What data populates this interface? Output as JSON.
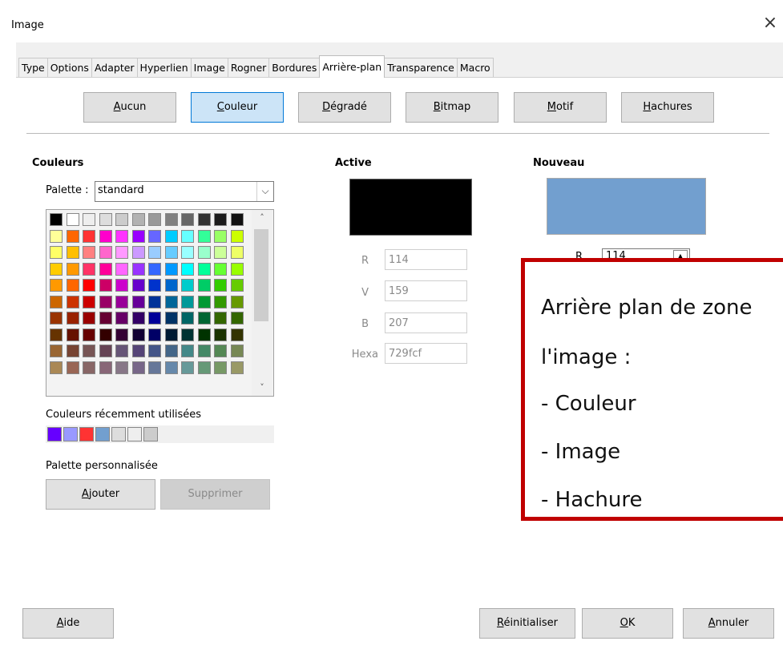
{
  "window": {
    "title": "Image",
    "close": "×"
  },
  "tabs": [
    "Type",
    "Options",
    "Adapter",
    "Hyperlien",
    "Image",
    "Rogner",
    "Bordures",
    "Arrière-plan",
    "Transparence",
    "Macro"
  ],
  "active_tab": "Arrière-plan",
  "fill_types": [
    {
      "key": "A",
      "rest": "ucun"
    },
    {
      "key": "C",
      "rest": "ouleur"
    },
    {
      "key": "D",
      "rest": "égradé"
    },
    {
      "key": "B",
      "rest": "itmap"
    },
    {
      "key": "M",
      "rest": "otif"
    },
    {
      "key": "H",
      "rest": "achures"
    }
  ],
  "colors_section": {
    "title": "Couleurs",
    "palette_label": "Palette :",
    "palette_value": "standard",
    "recent_label": "Couleurs récemment utilisées",
    "custom_label": "Palette personnalisée",
    "add_key": "A",
    "add_rest": "jouter",
    "delete_label": "Supprimer"
  },
  "palette_colors": [
    [
      "#000000",
      "#ffffff",
      "#eeeeee",
      "#dddddd",
      "#cccccc",
      "#b2b2b2",
      "#999999",
      "#808080",
      "#666666",
      "#333333",
      "#1c1c1c",
      "#111111"
    ],
    [
      "#ffff99",
      "#ff6600",
      "#ff3333",
      "#ff00cc",
      "#ff33ff",
      "#9900ff",
      "#6666ff",
      "#00ccff",
      "#66ffff",
      "#33ff99",
      "#99ff66",
      "#ccff00"
    ],
    [
      "#ffff66",
      "#ffbf00",
      "#ff8080",
      "#ff66cc",
      "#ff99ff",
      "#cc99ff",
      "#99ccff",
      "#66ccff",
      "#99ffff",
      "#99ffcc",
      "#ccff99",
      "#eeff66"
    ],
    [
      "#ffcc00",
      "#ff9900",
      "#ff3366",
      "#ff0099",
      "#ff66ff",
      "#9933ff",
      "#3366ff",
      "#0099ff",
      "#00ffff",
      "#00ff99",
      "#66ff33",
      "#99ff00"
    ],
    [
      "#ff9900",
      "#ff6600",
      "#ff0000",
      "#cc0066",
      "#cc00cc",
      "#6600cc",
      "#0033cc",
      "#0066cc",
      "#00cccc",
      "#00cc66",
      "#33cc00",
      "#66cc00"
    ],
    [
      "#cc6600",
      "#cc3300",
      "#cc0000",
      "#990066",
      "#990099",
      "#660099",
      "#003399",
      "#006699",
      "#009999",
      "#009933",
      "#339900",
      "#669900"
    ],
    [
      "#993300",
      "#992200",
      "#990000",
      "#660033",
      "#660066",
      "#330066",
      "#000099",
      "#003366",
      "#006666",
      "#006633",
      "#336600",
      "#336600"
    ],
    [
      "#663300",
      "#661100",
      "#660000",
      "#330000",
      "#330033",
      "#110033",
      "#000066",
      "#001a33",
      "#003333",
      "#003300",
      "#1a3300",
      "#333300"
    ],
    [
      "#996633",
      "#774433",
      "#775555",
      "#664455",
      "#665577",
      "#554477",
      "#445588",
      "#446688",
      "#448888",
      "#448866",
      "#558855",
      "#778855"
    ],
    [
      "#aa8855",
      "#996655",
      "#886666",
      "#886677",
      "#887788",
      "#776688",
      "#667799",
      "#6688aa",
      "#669999",
      "#669977",
      "#779966",
      "#999966"
    ]
  ],
  "recent_colors": [
    "#6600ff",
    "#9999ff",
    "#ff3333",
    "#729fcf",
    "#dddddd",
    "#eeeeee",
    "#cccccc"
  ],
  "active": {
    "title": "Active",
    "color": "#000000"
  },
  "new": {
    "title": "Nouveau",
    "color": "#729fcf"
  },
  "fields": {
    "r_label": "R",
    "r_value": "114",
    "v_label": "V",
    "v_value": "159",
    "b_label": "B",
    "b_value": "207",
    "hex_label": "Hexa",
    "hex_value": "729fcf"
  },
  "new_r_label": "R",
  "new_r_value": "114",
  "annotation": {
    "lines": [
      "Arrière plan de zone",
      "l'image  :",
      "- Couleur",
      "- Image",
      "- Hachure"
    ]
  },
  "bottom": {
    "help_key": "A",
    "help_rest": "ide",
    "reset_key": "R",
    "reset_rest": "éinitialiser",
    "ok_key": "O",
    "ok_rest": "K",
    "cancel_key": "A",
    "cancel_rest": "nnuler"
  }
}
